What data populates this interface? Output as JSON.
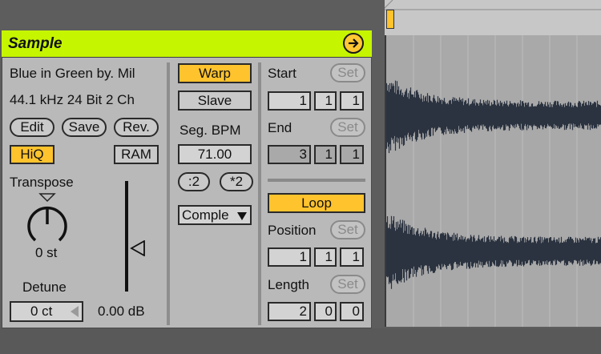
{
  "clip": {
    "header_title": "Sample",
    "sample_name": "Blue in Green by. Mil",
    "sample_info": "44.1 kHz 24 Bit 2 Ch",
    "edit_label": "Edit",
    "save_label": "Save",
    "rev_label": "Rev.",
    "hiq_label": "HiQ",
    "ram_label": "RAM",
    "transpose_label": "Transpose",
    "transpose_value": "0 st",
    "detune_label": "Detune",
    "detune_value": "0 ct",
    "gain_value": "0.00 dB"
  },
  "warp": {
    "warp_label": "Warp",
    "slave_label": "Slave",
    "seg_bpm_label": "Seg. BPM",
    "seg_bpm_value": "71.00",
    "half_label": ":2",
    "double_label": "*2",
    "warp_mode": "Comple"
  },
  "markers": {
    "start_label": "Start",
    "end_label": "End",
    "loop_label": "Loop",
    "position_label": "Position",
    "length_label": "Length",
    "set_label": "Set",
    "start_values": [
      "1",
      "1",
      "1"
    ],
    "end_values": [
      "3",
      "1",
      "1"
    ],
    "position_values": [
      "1",
      "1",
      "1"
    ],
    "length_values": [
      "2",
      "0",
      "0"
    ]
  },
  "colors": {
    "header_green": "#c6f500",
    "active_orange": "#ffc32d",
    "panel_gray": "#b9b9b9",
    "waveform": "#2b3340"
  },
  "icons": [
    "arrow-right-icon",
    "transpose-knob-icon",
    "dropdown-triangle-icon",
    "gain-slider-triangle-icon"
  ]
}
